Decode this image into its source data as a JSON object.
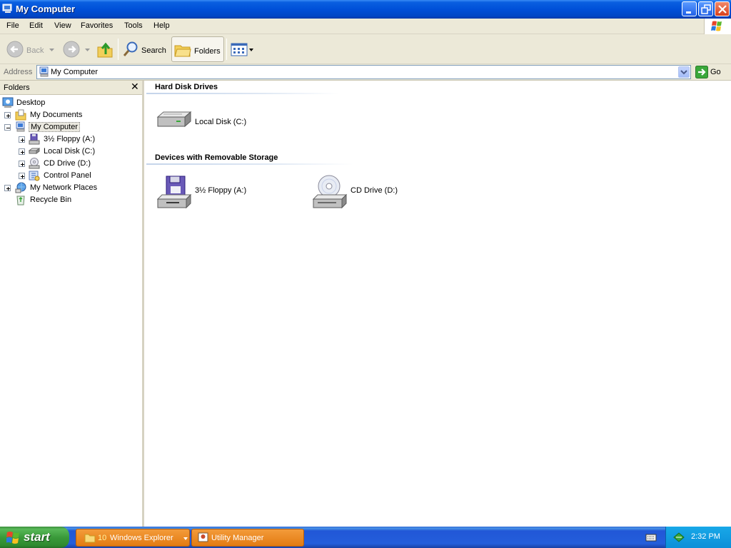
{
  "window": {
    "title": "My Computer",
    "controls": [
      "minimize",
      "maximize",
      "close"
    ]
  },
  "menubar": {
    "items": [
      "File",
      "Edit",
      "View",
      "Favorites",
      "Tools",
      "Help"
    ]
  },
  "toolbar": {
    "back_label": "Back",
    "search_label": "Search",
    "folders_label": "Folders"
  },
  "addressbar": {
    "label": "Address",
    "value": "My Computer",
    "go_label": "Go"
  },
  "folders_pane": {
    "title": "Folders",
    "close_glyph": "✕",
    "tree": [
      {
        "label": "Desktop",
        "level": 0,
        "expander": "none",
        "icon": "desktop-icon"
      },
      {
        "label": "My Documents",
        "level": 1,
        "expander": "plus",
        "icon": "my-documents-icon"
      },
      {
        "label": "My Computer",
        "level": 1,
        "expander": "minus",
        "icon": "my-computer-icon",
        "selected": true
      },
      {
        "label": "3½ Floppy (A:)",
        "level": 2,
        "expander": "plus",
        "icon": "floppy-drive-icon"
      },
      {
        "label": "Local Disk (C:)",
        "level": 2,
        "expander": "plus",
        "icon": "hard-disk-icon"
      },
      {
        "label": "CD Drive (D:)",
        "level": 2,
        "expander": "plus",
        "icon": "cd-drive-icon"
      },
      {
        "label": "Control Panel",
        "level": 2,
        "expander": "plus",
        "icon": "control-panel-icon"
      },
      {
        "label": "My Network Places",
        "level": 1,
        "expander": "plus",
        "icon": "network-places-icon"
      },
      {
        "label": "Recycle Bin",
        "level": 1,
        "expander": "none",
        "icon": "recycle-bin-icon"
      }
    ]
  },
  "main": {
    "groups": [
      {
        "title": "Hard Disk Drives",
        "items": [
          {
            "label": "Local Disk (C:)",
            "icon": "hard-disk-icon"
          }
        ]
      },
      {
        "title": "Devices with Removable Storage",
        "items": [
          {
            "label": "3½ Floppy (A:)",
            "icon": "floppy-drive-icon"
          },
          {
            "label": "CD Drive (D:)",
            "icon": "cd-drive-icon"
          }
        ]
      }
    ]
  },
  "taskbar": {
    "start_label": "start",
    "tasks": [
      {
        "count": "10",
        "label": "Windows Explorer"
      },
      {
        "label": "Utility Manager"
      }
    ],
    "clock": "2:32 PM"
  },
  "colors": {
    "titlebar": "#0050d8",
    "chrome": "#ece9d8",
    "taskbar": "#245edb",
    "start_button": "#3a9a3a",
    "task_button": "#e37b12",
    "tray": "#0c8fd8"
  }
}
